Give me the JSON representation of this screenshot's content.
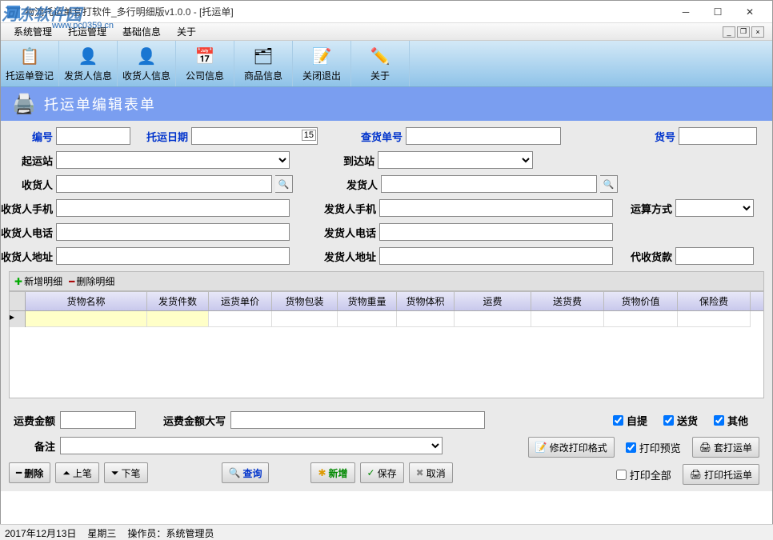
{
  "window": {
    "title": "物流托运单套打软件_多行明细版v1.0.0 - [托运单]"
  },
  "watermark": {
    "main": "河东软件园",
    "sub": "www.pc0359.cn"
  },
  "menubar": {
    "items": [
      "系统管理",
      "托运管理",
      "基础信息",
      "关于"
    ]
  },
  "toolbar": {
    "items": [
      {
        "label": "托运单登记",
        "icon": "📋"
      },
      {
        "label": "发货人信息",
        "icon": "👤"
      },
      {
        "label": "收货人信息",
        "icon": "👤"
      },
      {
        "label": "公司信息",
        "icon": "📅"
      },
      {
        "label": "商品信息",
        "icon": "🗂"
      },
      {
        "label": "关闭退出",
        "icon": "📝"
      },
      {
        "label": "关于",
        "icon": "✏️"
      }
    ]
  },
  "form": {
    "title": "托运单编辑表单",
    "labels": {
      "number": "编号",
      "consign_date": "托运日期",
      "query_no": "查货单号",
      "cargo_no": "货号",
      "origin": "起运站",
      "dest": "到达站",
      "receiver": "收货人",
      "sender": "发货人",
      "receiver_mobile": "收货人手机",
      "sender_mobile": "发货人手机",
      "settle_method": "运算方式",
      "receiver_phone": "收货人电话",
      "sender_phone": "发货人电话",
      "receiver_addr": "收货人地址",
      "sender_addr": "发货人地址",
      "cod": "代收货款"
    },
    "values": {
      "number": "",
      "consign_date": "",
      "query_no": "",
      "cargo_no": "",
      "origin": "",
      "dest": "",
      "receiver": "",
      "sender": "",
      "receiver_mobile": "",
      "sender_mobile": "",
      "settle_method": "",
      "receiver_phone": "",
      "sender_phone": "",
      "receiver_addr": "",
      "sender_addr": "",
      "cod": ""
    }
  },
  "detail": {
    "add_btn": "新增明细",
    "del_btn": "删除明细",
    "columns": [
      "货物名称",
      "发货件数",
      "运货单价",
      "货物包装",
      "货物重量",
      "货物体积",
      "运费",
      "送货费",
      "货物价值",
      "保险费"
    ],
    "rows": [
      []
    ]
  },
  "bottom": {
    "labels": {
      "freight_amount": "运费金额",
      "freight_words": "运费金额大写",
      "remark": "备注"
    },
    "values": {
      "freight_amount": "",
      "freight_words": "",
      "remark": ""
    },
    "checks": {
      "pickup": "自提",
      "delivery": "送货",
      "other": "其他",
      "print_preview": "打印预览",
      "print_all": "打印全部"
    }
  },
  "actions": {
    "delete": "删除",
    "prev": "上笔",
    "next": "下笔",
    "query": "查询",
    "add": "新增",
    "save": "保存",
    "cancel": "取消",
    "modify_format": "修改打印格式",
    "print_set": "套打运单",
    "print_waybill": "打印托运单"
  },
  "status": {
    "date": "2017年12月13日",
    "weekday": "星期三",
    "operator_label": "操作员：",
    "operator": "系统管理员"
  }
}
